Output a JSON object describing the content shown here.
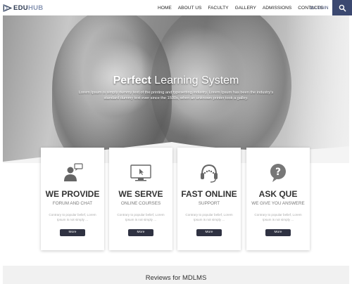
{
  "nav": {
    "logo_part1": "EDU",
    "logo_part2": "HUB",
    "items": [
      "HOME",
      "ABOUT US",
      "FACULTY",
      "GALLERY",
      "ADMISSIONS",
      "CONTACTS"
    ],
    "login": "LOGIN",
    "search_icon": "search-icon"
  },
  "hero": {
    "title_strong": "Perfect",
    "title_rest": " Learning System",
    "description": "Lorem Ipsum is simply dummy text of the printing and typesetting industry. Lorem Ipsum has been the industry's standard dummy text ever since the 1500s, when an unknown printer took a galley."
  },
  "cards": [
    {
      "icon": "support-person-icon",
      "title": "WE PROVIDE",
      "subtitle": "FORUM AND CHAT",
      "text": "Contrary to popular belief, Lorem Ipsum is not simply ...",
      "button": "More"
    },
    {
      "icon": "monitor-icon",
      "title": "WE SERVE",
      "subtitle": "ONLINE COURSES",
      "text": "Contrary to popular belief, Lorem Ipsum is not simply ...",
      "button": "More"
    },
    {
      "icon": "headset-icon",
      "title": "FAST ONLINE",
      "subtitle": "SUPPORT",
      "text": "Contrary to popular belief, Lorem Ipsum is not simply ...",
      "button": "More"
    },
    {
      "icon": "question-bubble-icon",
      "title": "ASK QUE",
      "subtitle": "WE GIVE YOU ANSWERE",
      "text": "Contrary to popular belief, Lorem Ipsum is not simply ...",
      "button": "More"
    }
  ],
  "reviews": {
    "title": "Reviews for MDLMS"
  },
  "colors": {
    "accent": "#3b4870",
    "button": "#2f3242"
  }
}
